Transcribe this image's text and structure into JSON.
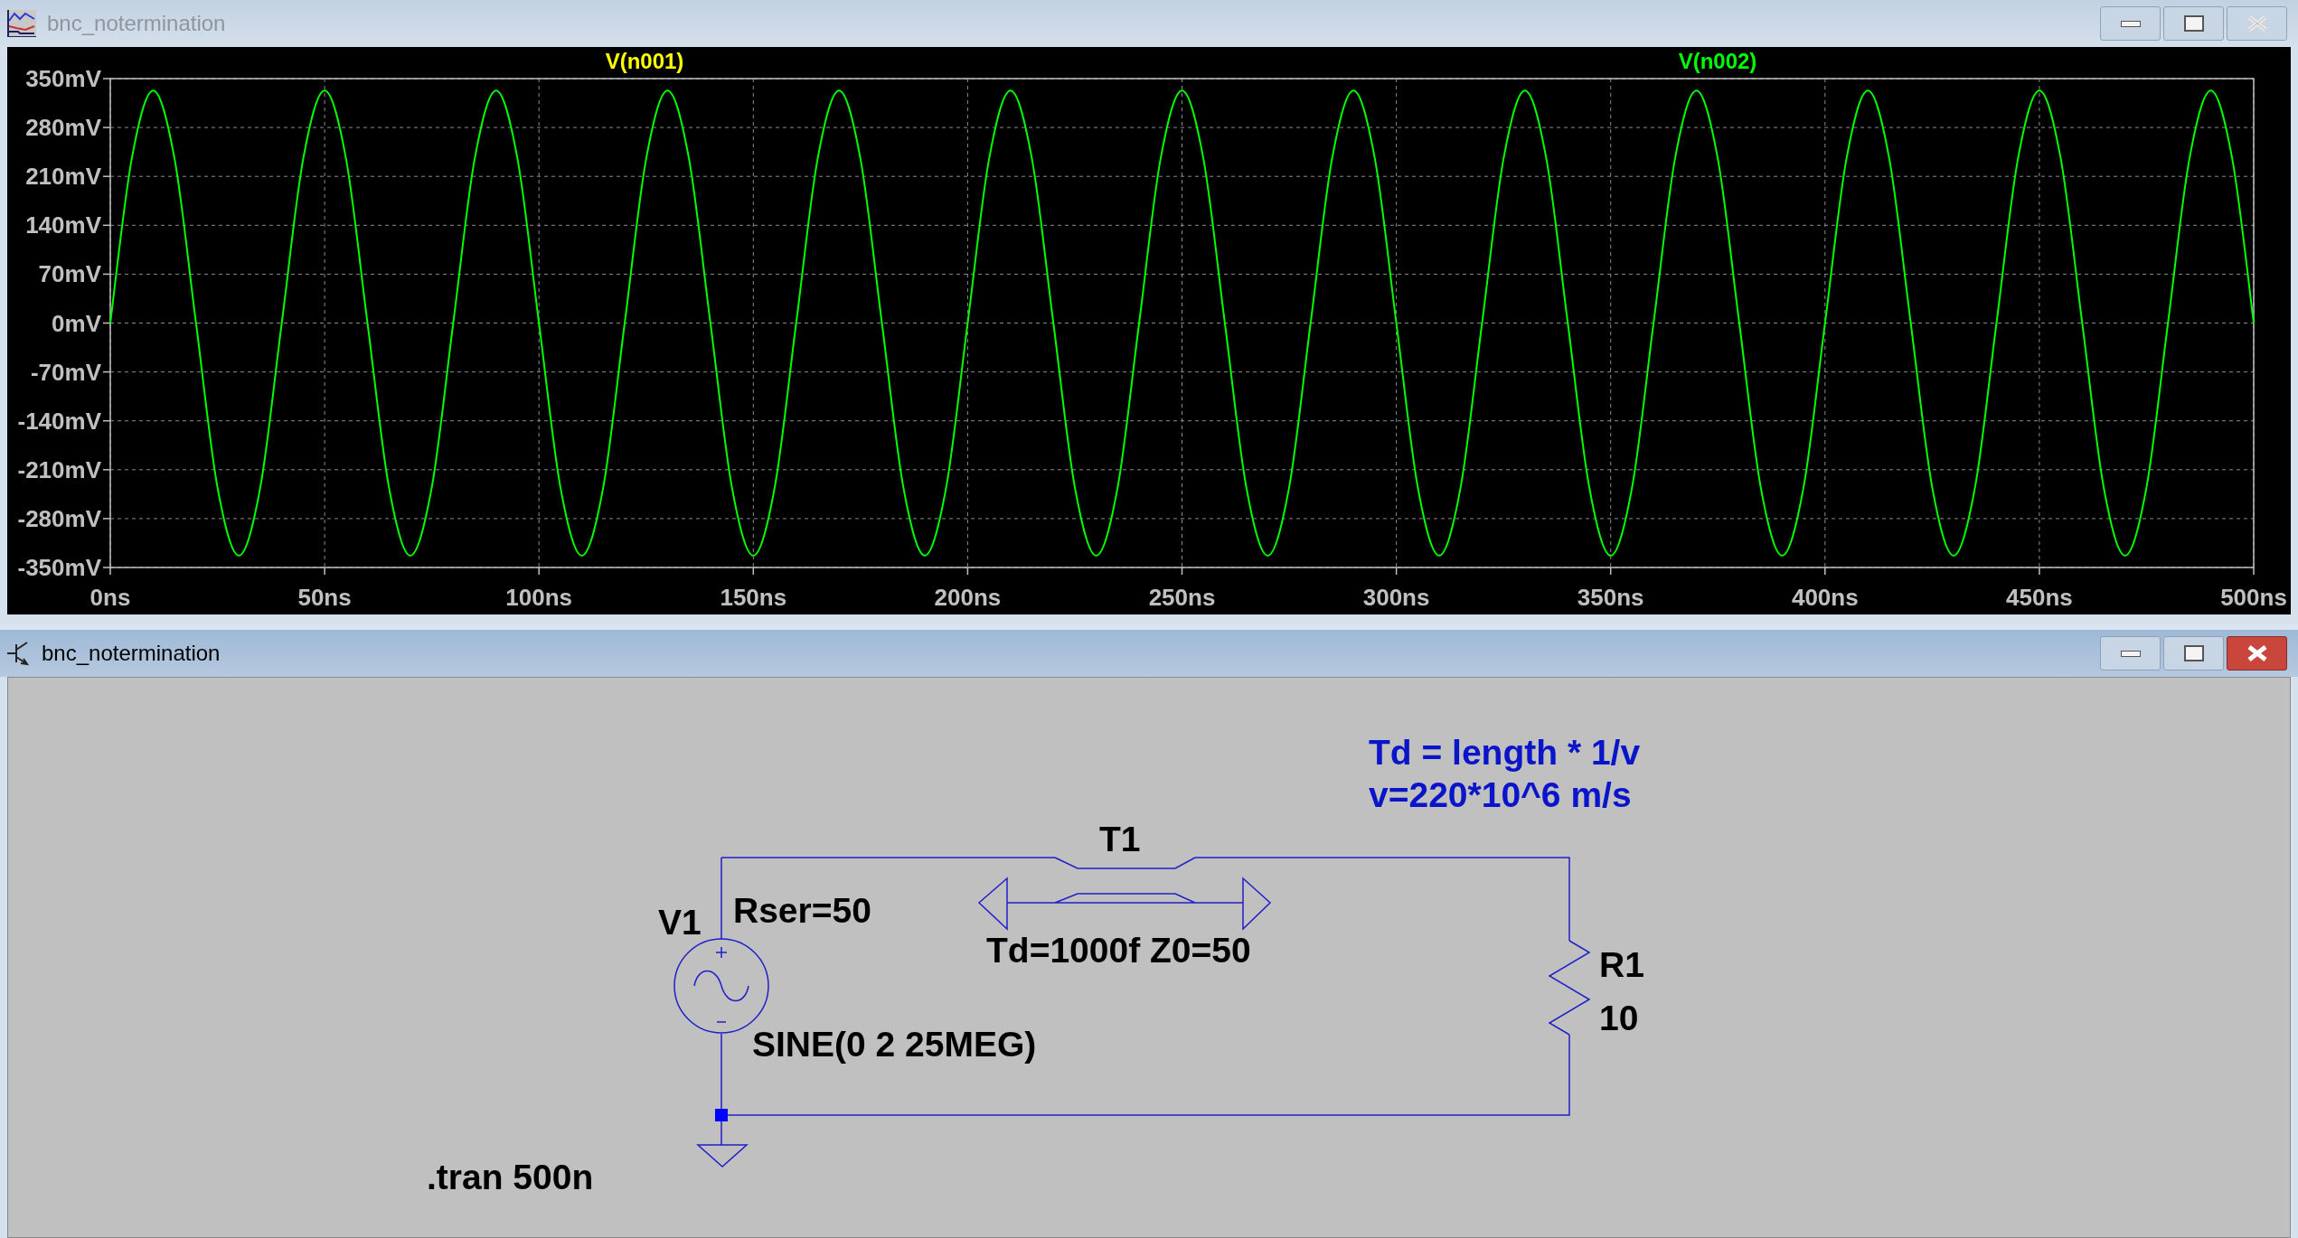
{
  "waveform_window": {
    "title": "bnc_notermination",
    "active": false,
    "chart_data": {
      "type": "line",
      "grid": true,
      "xlim": [
        0,
        500
      ],
      "ylim": [
        -350,
        350
      ],
      "xticks": [
        {
          "value": 0,
          "label": "0ns"
        },
        {
          "value": 50,
          "label": "50ns"
        },
        {
          "value": 100,
          "label": "100ns"
        },
        {
          "value": 150,
          "label": "150ns"
        },
        {
          "value": 200,
          "label": "200ns"
        },
        {
          "value": 250,
          "label": "250ns"
        },
        {
          "value": 300,
          "label": "300ns"
        },
        {
          "value": 350,
          "label": "350ns"
        },
        {
          "value": 400,
          "label": "400ns"
        },
        {
          "value": 450,
          "label": "450ns"
        },
        {
          "value": 500,
          "label": "500ns"
        }
      ],
      "yticks": [
        {
          "value": 350,
          "label": "350mV"
        },
        {
          "value": 280,
          "label": "280mV"
        },
        {
          "value": 210,
          "label": "210mV"
        },
        {
          "value": 140,
          "label": "140mV"
        },
        {
          "value": 70,
          "label": "70mV"
        },
        {
          "value": 0,
          "label": "0mV"
        },
        {
          "value": -70,
          "label": "-70mV"
        },
        {
          "value": -140,
          "label": "-140mV"
        },
        {
          "value": -210,
          "label": "-210mV"
        },
        {
          "value": -280,
          "label": "-280mV"
        },
        {
          "value": -350,
          "label": "-350mV"
        }
      ],
      "x": [
        0,
        5,
        10,
        15,
        20,
        25,
        30,
        35,
        40,
        45,
        50,
        55,
        60,
        65,
        70,
        75,
        80,
        85,
        90,
        95,
        100,
        105,
        110,
        115,
        120,
        125,
        130,
        135,
        140,
        145,
        150,
        155,
        160,
        165,
        170,
        175,
        180,
        185,
        190,
        195,
        200,
        205,
        210,
        215,
        220,
        225,
        230,
        235,
        240,
        245,
        250,
        255,
        260,
        265,
        270,
        275,
        280,
        285,
        290,
        295,
        300,
        305,
        310,
        315,
        320,
        325,
        330,
        335,
        340,
        345,
        350,
        355,
        360,
        365,
        370,
        375,
        380,
        385,
        390,
        395,
        400,
        405,
        410,
        415,
        420,
        425,
        430,
        435,
        440,
        445,
        450,
        455,
        460,
        465,
        470,
        475,
        480,
        485,
        490,
        495,
        500
      ],
      "series": [
        {
          "name": "V(n001)",
          "color": "#ffff00",
          "values": [
            null,
            null,
            null,
            null,
            null,
            null,
            null,
            null,
            null,
            null,
            null,
            null,
            null,
            null,
            null,
            null,
            null,
            null,
            null,
            null,
            null,
            null,
            null,
            null,
            null,
            null,
            null,
            null,
            null,
            null,
            null,
            null,
            null,
            null,
            null,
            null,
            null,
            null,
            null,
            null,
            null,
            null,
            null,
            null,
            null,
            null,
            null,
            null,
            null,
            null,
            null,
            null,
            null,
            null,
            null,
            null,
            null,
            null,
            null,
            null,
            null,
            null,
            null,
            null,
            null,
            null,
            null,
            null,
            null,
            null,
            null,
            null,
            null,
            null,
            null,
            null,
            null,
            null,
            null,
            null,
            null,
            null,
            null,
            null,
            null,
            null,
            null,
            null,
            null,
            null,
            null,
            null,
            null,
            null,
            null,
            null,
            null,
            null,
            null,
            null,
            null
          ]
        },
        {
          "name": "V(n002)",
          "color": "#00ff00",
          "values": [
            0,
            235,
            333,
            235,
            0,
            -235,
            -333,
            -235,
            0,
            235,
            333,
            235,
            0,
            -235,
            -333,
            -235,
            0,
            235,
            333,
            235,
            0,
            -235,
            -333,
            -235,
            0,
            235,
            333,
            235,
            0,
            -235,
            -333,
            -235,
            0,
            235,
            333,
            235,
            0,
            -235,
            -333,
            -235,
            0,
            235,
            333,
            235,
            0,
            -235,
            -333,
            -235,
            0,
            235,
            333,
            235,
            0,
            -235,
            -333,
            -235,
            0,
            235,
            333,
            235,
            0,
            -235,
            -333,
            -235,
            0,
            235,
            333,
            235,
            0,
            -235,
            -333,
            -235,
            0,
            235,
            333,
            235,
            0,
            -235,
            -333,
            -235,
            0,
            235,
            333,
            235,
            0,
            -235,
            -333,
            -235,
            0,
            235,
            333,
            235,
            0,
            -235,
            -333,
            -235,
            0,
            235,
            333,
            235,
            0
          ]
        }
      ]
    }
  },
  "schematic_window": {
    "title": "bnc_notermination",
    "active": true,
    "components": [
      {
        "kind": "voltage_source",
        "name": "V1",
        "value": "SINE(0 2 25MEG)",
        "parameter": "Rser=50"
      },
      {
        "kind": "transmission_line",
        "name": "T1",
        "value": "Td=1000f Z0=50"
      },
      {
        "kind": "resistor",
        "name": "R1",
        "value": "10"
      }
    ],
    "directives": [
      {
        "kind": "comment",
        "lines": [
          "Td = length * 1/v",
          "v=220*10^6 m/s"
        ]
      },
      {
        "kind": "spice",
        "lines": [
          ".tran 500n"
        ]
      }
    ]
  }
}
